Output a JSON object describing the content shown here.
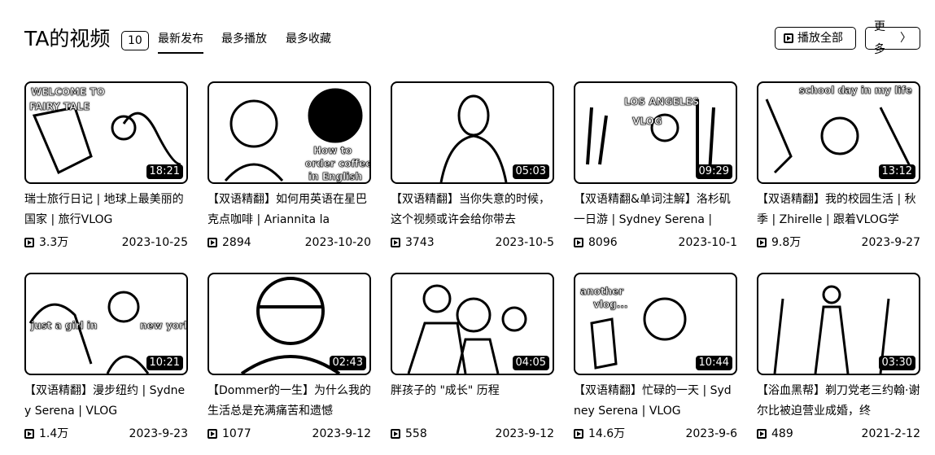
{
  "header": {
    "title": "TA的视频",
    "count": "10",
    "tabs": [
      {
        "label": "最新发布",
        "active": true
      },
      {
        "label": "最多播放",
        "active": false
      },
      {
        "label": "最多收藏",
        "active": false
      }
    ],
    "play_all_label": "播放全部",
    "more_label": "更多"
  },
  "videos": [
    {
      "title": "瑞士旅行日记 | 地球上最美丽的国家 | 旅行VLOG",
      "duration": "18:21",
      "views": "3.3万",
      "date": "2023-10-25",
      "thumb_text": [
        "WELCOME TO",
        "FAIRY TALE"
      ]
    },
    {
      "title": "【双语精翻】如何用英语在星巴克点咖啡 | Ariannita la",
      "duration": "",
      "views": "2894",
      "date": "2023-10-20",
      "thumb_text": [
        "How to",
        "order coffee",
        "in English"
      ]
    },
    {
      "title": "【双语精翻】当你失意的时候，这个视频或许会给你带去",
      "duration": "05:03",
      "views": "3743",
      "date": "2023-10-5",
      "thumb_text": []
    },
    {
      "title": "【双语精翻&单词注解】洛杉矶一日游 | Sydney Serena |",
      "duration": "09:29",
      "views": "8096",
      "date": "2023-10-1",
      "thumb_text": [
        "LOS ANGELES",
        "VLOG"
      ]
    },
    {
      "title": "【双语精翻】我的校园生活 | 秋季 | Zhirelle | 跟着VLOG学",
      "duration": "13:12",
      "views": "9.8万",
      "date": "2023-9-27",
      "thumb_text": [
        "school day in my life"
      ]
    },
    {
      "title": "【双语精翻】漫步纽约 | Sydney Serena | VLOG",
      "duration": "10:21",
      "views": "1.4万",
      "date": "2023-9-23",
      "thumb_text": [
        "just a girl in",
        "new york"
      ]
    },
    {
      "title": "【Dommer的一生】为什么我的生活总是充满痛苦和遗憾",
      "duration": "02:43",
      "views": "1077",
      "date": "2023-9-12",
      "thumb_text": []
    },
    {
      "title": "胖孩子的 \"成长\" 历程",
      "duration": "04:05",
      "views": "558",
      "date": "2023-9-12",
      "thumb_text": []
    },
    {
      "title": "【双语精翻】忙碌的一天 | Sydney Serena | VLOG",
      "duration": "10:44",
      "views": "14.6万",
      "date": "2023-9-6",
      "thumb_text": [
        "another",
        "vlog..."
      ]
    },
    {
      "title": "【浴血黑帮】剃刀党老三约翰·谢尔比被迫营业成婚，终",
      "duration": "03:30",
      "views": "489",
      "date": "2021-2-12",
      "thumb_text": []
    }
  ]
}
